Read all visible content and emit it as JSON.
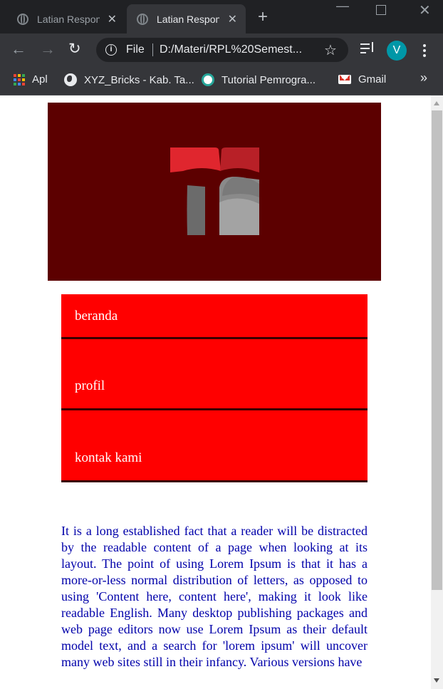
{
  "browser": {
    "tabs": [
      {
        "title": "Latian Respon",
        "active": false
      },
      {
        "title": "Latian Respon",
        "active": true
      }
    ],
    "address": {
      "scheme_label": "File",
      "url": "D:/Materi/RPL%20Semest..."
    },
    "profile_initial": "V",
    "bookmarks": [
      {
        "label": "Apl",
        "icon": "apps-grid-icon"
      },
      {
        "label": "XYZ_Bricks - Kab. Ta...",
        "icon": "globe-icon"
      },
      {
        "label": "Tutorial Pemrogra...",
        "icon": "tutorial-icon"
      },
      {
        "label": "Gmail",
        "icon": "gmail-icon"
      }
    ],
    "more_bookmarks": "»"
  },
  "page": {
    "banner": {
      "background": "#5c0000",
      "logo": "tutwuri-logo"
    },
    "nav": [
      {
        "label": "beranda"
      },
      {
        "label": "profil"
      },
      {
        "label": "kontak kami"
      }
    ],
    "nav_color": "#ff0000",
    "content": "It is a long established fact that a reader will be distracted by the readable content of a page when looking at its layout. The point of using Lorem Ipsum is that it has a more-or-less normal distribution of letters, as opposed to using 'Content here, content here', making it look like readable English. Many desktop publishing packages and web page editors now use Lorem Ipsum as their default model text, and a search for 'lorem ipsum' will uncover many web sites still in their infancy. Various versions have",
    "content_color": "#0000aa"
  }
}
